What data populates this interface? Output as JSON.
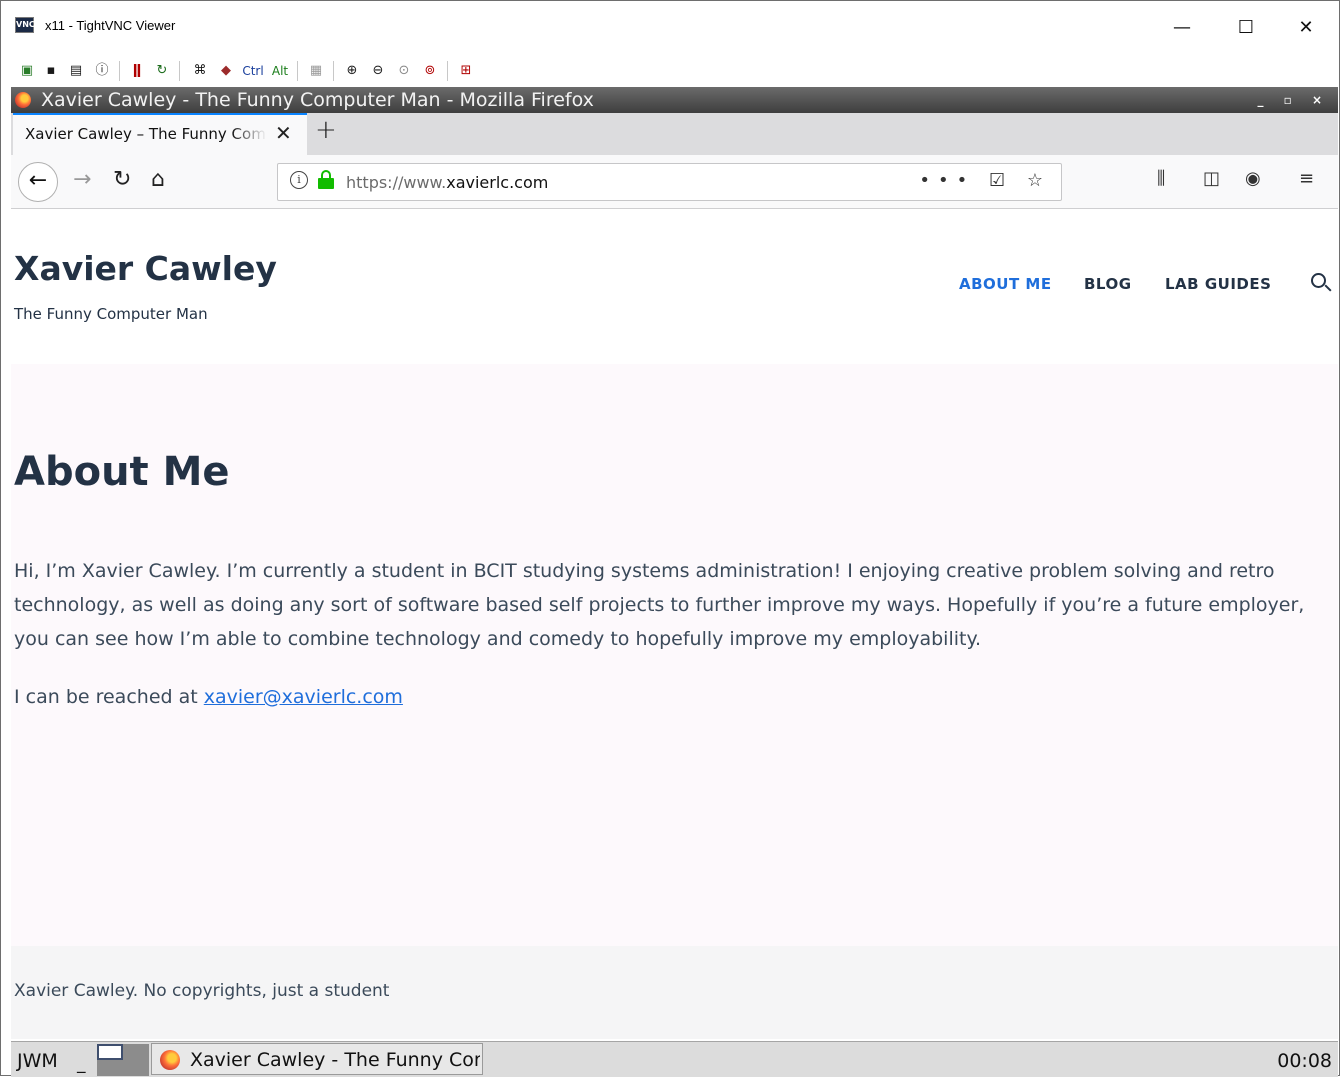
{
  "vnc": {
    "title": "x11 - TightVNC Viewer",
    "icon_text": "VNC",
    "controls": {
      "minimize": "—",
      "maximize": "☐",
      "close": "✕"
    },
    "toolbar": {
      "ctrl_label": "Ctrl",
      "alt_label": "Alt",
      "icons": [
        "new-connection-icon",
        "save-icon",
        "options-icon",
        "info-icon",
        "pause-icon",
        "refresh-icon",
        "send-ctrl-alt-del-icon",
        "send-ctrl-esc-icon",
        "ctrl-key-icon",
        "alt-key-icon",
        "clipboard-icon",
        "zoom-in-icon",
        "zoom-out-icon",
        "zoom-100-icon",
        "zoom-auto-icon",
        "fullscreen-icon"
      ]
    }
  },
  "firefox": {
    "window_title": "Xavier Cawley - The Funny Computer Man - Mozilla Firefox",
    "window_controls": "_ ▫ ×",
    "tab": {
      "title": "Xavier Cawley – The Funny Computer Man",
      "close": "✕"
    },
    "new_tab": "+",
    "url": {
      "scheme": "https://www.",
      "domain": "xavierlc.com"
    },
    "url_actions": "••• ☑ ☆",
    "colors": {
      "accent": "#0a84ff",
      "lock": "#12bc00"
    }
  },
  "site": {
    "title": "Xavier Cawley",
    "tagline": "The Funny Computer Man",
    "nav": [
      {
        "label": "ABOUT ME",
        "active": true
      },
      {
        "label": "BLOG",
        "active": false
      },
      {
        "label": "LAB GUIDES",
        "active": false
      }
    ],
    "heading": "About Me",
    "paragraph": "Hi, I’m Xavier Cawley. I’m currently a student in BCIT studying systems administration! I enjoying creative problem solving and retro technology, as well as doing any sort of software based self projects to further improve my ways. Hopefully if you’re a future employer, you can see how I’m able to combine technology and comedy to hopefully improve my employability.",
    "contact_prefix": "I can be reached at ",
    "email": "xavier@xavierlc.com",
    "footer": "Xavier Cawley. No copyrights, just a student",
    "colors": {
      "heading": "#233245",
      "link": "#1f6edb",
      "content_bg": "#fdf9fc"
    }
  },
  "taskbar": {
    "menu": "JWM",
    "separator": "_",
    "task_title": "Xavier Cawley - The Funny Computer Man",
    "clock": "00:08"
  }
}
